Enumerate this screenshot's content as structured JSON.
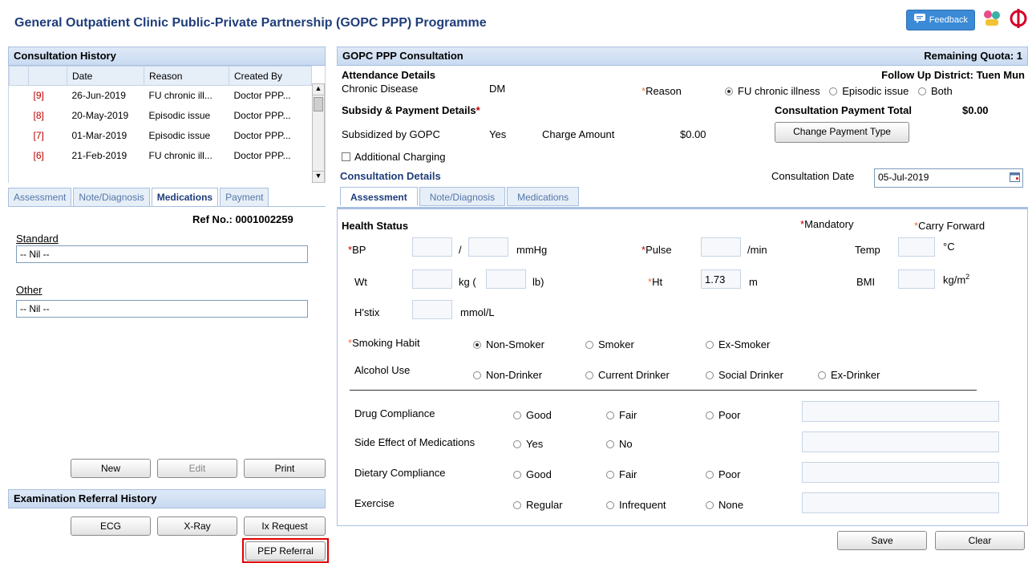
{
  "header": {
    "title": "General Outpatient Clinic Public-Private Partnership (GOPC PPP) Programme",
    "feedback_label": "Feedback"
  },
  "history": {
    "title": "Consultation History",
    "columns": [
      "Date",
      "Reason",
      "Created By"
    ],
    "rows": [
      {
        "no": "[9]",
        "date": "26-Jun-2019",
        "reason": "FU chronic ill...",
        "by": "Doctor PPP..."
      },
      {
        "no": "[8]",
        "date": "20-May-2019",
        "reason": "Episodic issue",
        "by": "Doctor PPP..."
      },
      {
        "no": "[7]",
        "date": "01-Mar-2019",
        "reason": "Episodic issue",
        "by": "Doctor PPP..."
      },
      {
        "no": "[6]",
        "date": "21-Feb-2019",
        "reason": "FU chronic ill...",
        "by": "Doctor PPP..."
      }
    ]
  },
  "left_tabs": [
    "Assessment",
    "Note/Diagnosis",
    "Medications",
    "Payment"
  ],
  "medications": {
    "ref_label": "Ref No.: 0001002259",
    "standard_label": "Standard",
    "standard_value": "-- Nil --",
    "other_label": "Other",
    "other_value": "-- Nil --",
    "new_label": "New",
    "edit_label": "Edit",
    "print_label": "Print"
  },
  "exam_referral": {
    "title": "Examination Referral History",
    "ecg": "ECG",
    "xray": "X-Ray",
    "ix": "Ix Request",
    "pep": "PEP Referral"
  },
  "consultation": {
    "title": "GOPC PPP Consultation",
    "quota": "Remaining Quota: 1",
    "attendance_title": "Attendance Details",
    "district": "Follow Up District: Tuen Mun",
    "chronic_label": "Chronic Disease",
    "chronic_value": "DM",
    "reason_label": "Reason",
    "reason_options": [
      "FU chronic illness",
      "Episodic issue",
      "Both"
    ],
    "subsidy_title": "Subsidy & Payment Details",
    "payment_total_label": "Consultation Payment Total",
    "payment_total_value": "$0.00",
    "subsidized_label": "Subsidized by GOPC",
    "subsidized_value": "Yes",
    "charge_label": "Charge Amount",
    "charge_value": "$0.00",
    "change_payment": "Change Payment Type",
    "additional_charging": "Additional Charging",
    "details_title": "Consultation Details",
    "date_label": "Consultation Date",
    "date_value": "05-Jul-2019",
    "tabs": [
      "Assessment",
      "Note/Diagnosis",
      "Medications"
    ]
  },
  "assessment": {
    "health_status": "Health Status",
    "mandatory": "Mandatory",
    "carry_forward": "Carry Forward",
    "bp": "BP",
    "mmhg": "mmHg",
    "slash": "/",
    "pulse": "Pulse",
    "per_min": "/min",
    "temp": "Temp",
    "celsius": "°C",
    "wt": "Wt",
    "kg": "kg (",
    "lb": "lb)",
    "ht": "Ht",
    "ht_value": "1.73",
    "m": "m",
    "bmi": "BMI",
    "kgm": "kg/m",
    "kgm_sup": "2",
    "hstix": "H'stix",
    "mmol": "mmol/L",
    "smoking_label": "Smoking Habit",
    "smoking_options": [
      "Non-Smoker",
      "Smoker",
      "Ex-Smoker"
    ],
    "alcohol_label": "Alcohol Use",
    "alcohol_options": [
      "Non-Drinker",
      "Current Drinker",
      "Social Drinker",
      "Ex-Drinker"
    ],
    "drug_label": "Drug Compliance",
    "drug_options": [
      "Good",
      "Fair",
      "Poor"
    ],
    "side_label": "Side Effect of Medications",
    "side_options": [
      "Yes",
      "No"
    ],
    "diet_label": "Dietary Compliance",
    "diet_options": [
      "Good",
      "Fair",
      "Poor"
    ],
    "exercise_label": "Exercise",
    "exercise_options": [
      "Regular",
      "Infrequent",
      "None"
    ],
    "save": "Save",
    "clear": "Clear"
  }
}
